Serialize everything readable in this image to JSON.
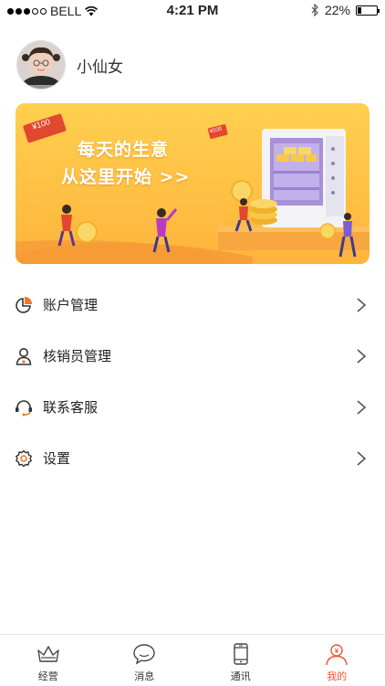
{
  "status_bar": {
    "carrier": "BELL",
    "signal_bars_filled": 3,
    "signal_bars_total": 5,
    "time": "4:21 PM",
    "battery": "22%",
    "battery_level": 0.22
  },
  "profile": {
    "username": "小仙女"
  },
  "banner": {
    "line1": "每天的生意",
    "line2": "从这里开始 >>",
    "tag1": "¥100",
    "tag2": "¥100"
  },
  "menu": {
    "items": [
      {
        "label": "账户管理",
        "icon": "pie-chart-icon"
      },
      {
        "label": "核销员管理",
        "icon": "person-icon"
      },
      {
        "label": "联系客服",
        "icon": "headset-icon"
      },
      {
        "label": "设置",
        "icon": "gear-icon"
      }
    ]
  },
  "tabbar": {
    "tabs": [
      {
        "label": "经营",
        "icon": "crown-icon",
        "active": false
      },
      {
        "label": "消息",
        "icon": "chat-bubble-icon",
        "active": false
      },
      {
        "label": "通讯",
        "icon": "phone-icon",
        "active": false
      },
      {
        "label": "我的",
        "icon": "user-profile-icon",
        "active": true
      }
    ]
  },
  "colors": {
    "accent": "#e8593b",
    "banner_gradient_top": "#ffc94a",
    "banner_gradient_bottom": "#ffb03a",
    "icon_orange": "#f07a2a"
  }
}
